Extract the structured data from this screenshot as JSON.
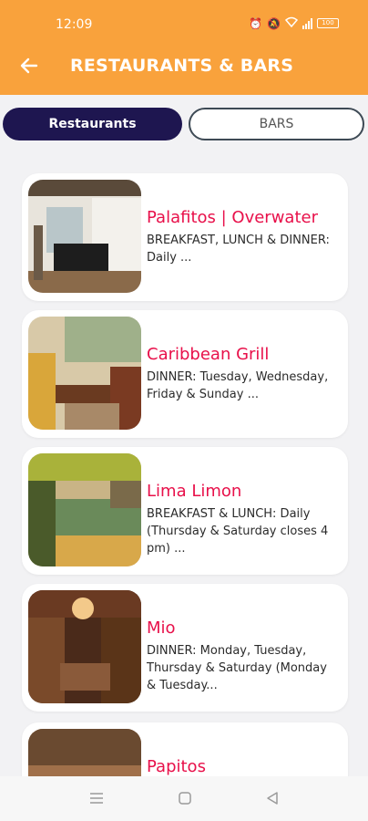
{
  "status_bar": {
    "time": "12:09",
    "battery": "100"
  },
  "header": {
    "title": "RESTAURANTS & BARS",
    "back_icon": "arrow-left-icon",
    "background_color": "#f9a23c"
  },
  "tabs": [
    {
      "label": "Restaurants",
      "active": true
    },
    {
      "label": "BARS",
      "active": false
    }
  ],
  "restaurants": [
    {
      "name": "Palafitos | Overwater",
      "description": "BREAKFAST, LUNCH & DINNER: Daily ..."
    },
    {
      "name": "Caribbean Grill",
      "description": "DINNER: Tuesday, Wednesday, Friday & Sunday ..."
    },
    {
      "name": "Lima Limon",
      "description": "BREAKFAST & LUNCH: Daily (Thursday & Saturday closes 4 pm) ..."
    },
    {
      "name": "Mio",
      "description": "DINNER: Monday, Tuesday, Thursday & Saturday (Monday & Tuesday..."
    },
    {
      "name": "Papitos",
      "description": ""
    }
  ],
  "colors": {
    "accent": "#e8104a",
    "active_tab": "#1e1650"
  },
  "nav_bar": {
    "icons": [
      "menu-icon",
      "home-square-icon",
      "back-triangle-icon"
    ]
  }
}
